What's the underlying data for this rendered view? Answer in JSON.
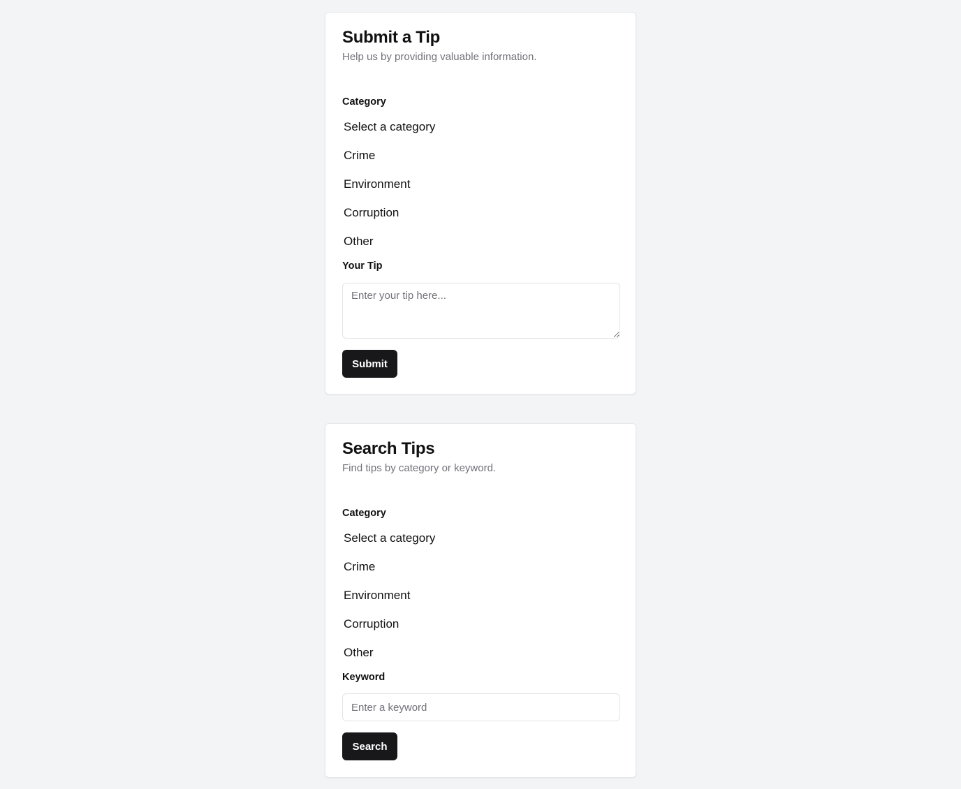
{
  "submit_form": {
    "title": "Submit a Tip",
    "subtitle": "Help us by providing valuable information.",
    "category_label": "Category",
    "category_options": [
      "Select a category",
      "Crime",
      "Environment",
      "Corruption",
      "Other"
    ],
    "tip_label": "Your Tip",
    "tip_placeholder": "Enter your tip here...",
    "submit_label": "Submit"
  },
  "search_form": {
    "title": "Search Tips",
    "subtitle": "Find tips by category or keyword.",
    "category_label": "Category",
    "category_options": [
      "Select a category",
      "Crime",
      "Environment",
      "Corruption",
      "Other"
    ],
    "keyword_label": "Keyword",
    "keyword_placeholder": "Enter a keyword",
    "search_label": "Search"
  },
  "colors": {
    "page_background": "#f3f4f6",
    "button_background": "#18181b",
    "muted_text": "#71717a"
  }
}
